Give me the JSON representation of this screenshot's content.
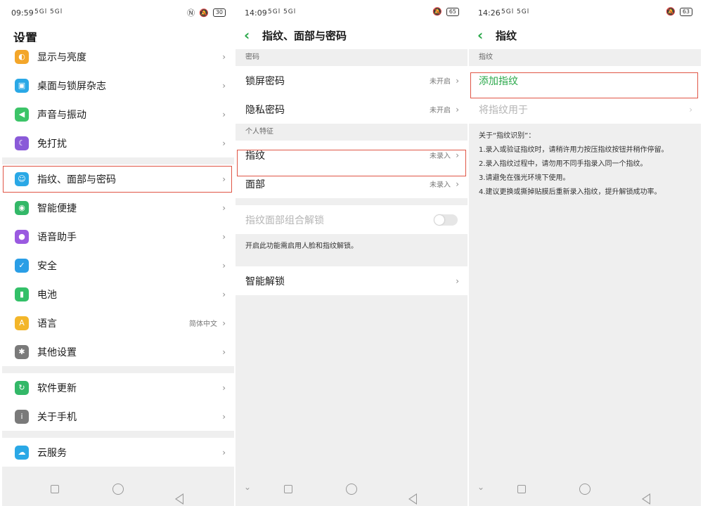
{
  "panel1": {
    "status": {
      "time": "09:59",
      "signal": "5Gl 5Gl",
      "battery": "30"
    },
    "title": "设置",
    "items": [
      {
        "label": "显示与亮度",
        "value": "",
        "icon": "brightness-icon",
        "color": "#f3a62a"
      },
      {
        "label": "桌面与锁屏杂志",
        "value": "",
        "icon": "wallpaper-icon",
        "color": "#2aa8e6"
      },
      {
        "label": "声音与振动",
        "value": "",
        "icon": "sound-icon",
        "color": "#3cc468"
      },
      {
        "label": "免打扰",
        "value": "",
        "icon": "moon-icon",
        "color": "#8a5ad8"
      },
      {
        "label": "指纹、面部与密码",
        "value": "",
        "icon": "fingerprint-face-icon",
        "color": "#2aa8e6"
      },
      {
        "label": "智能便捷",
        "value": "",
        "icon": "smart-icon",
        "color": "#33b868"
      },
      {
        "label": "语音助手",
        "value": "",
        "icon": "mic-icon",
        "color": "#9a5ae0"
      },
      {
        "label": "安全",
        "value": "",
        "icon": "shield-icon",
        "color": "#2a9ee6"
      },
      {
        "label": "电池",
        "value": "",
        "icon": "battery-icon",
        "color": "#33c068"
      },
      {
        "label": "语言",
        "value": "简体中文",
        "icon": "language-icon",
        "color": "#f3b62a"
      },
      {
        "label": "其他设置",
        "value": "",
        "icon": "gear-icon",
        "color": "#7a7a7a"
      },
      {
        "label": "软件更新",
        "value": "",
        "icon": "update-icon",
        "color": "#33b868"
      },
      {
        "label": "关于手机",
        "value": "",
        "icon": "info-icon",
        "color": "#7a7a7a"
      },
      {
        "label": "云服务",
        "value": "",
        "icon": "cloud-icon",
        "color": "#2aa8e6"
      }
    ]
  },
  "panel2": {
    "status": {
      "time": "14:09",
      "signal": "5Gl 5Gl",
      "battery": "65"
    },
    "title": "指纹、面部与密码",
    "section_password": "密码",
    "lock_password": "锁屏密码",
    "lock_password_value": "未开启",
    "privacy_password": "隐私密码",
    "privacy_password_value": "未开启",
    "section_personal": "个人特征",
    "fingerprint": "指纹",
    "fingerprint_value": "未录入",
    "face": "面部",
    "face_value": "未录入",
    "combo_unlock": "指纹面部组合解锁",
    "combo_note": "开启此功能需启用人脸和指纹解锁。",
    "smart_unlock": "智能解锁"
  },
  "panel3": {
    "status": {
      "time": "14:26",
      "signal": "5Gl 5Gl",
      "battery": "63"
    },
    "title": "指纹",
    "section": "指纹",
    "add_fingerprint": "添加指纹",
    "use_fingerprint_for": "将指纹用于",
    "about_title": "关于“指纹识别”：",
    "tips": [
      "1.录入或验证指纹时，请稍许用力按压指纹按钮并稍作停留。",
      "2.录入指纹过程中，请勿用不同手指录入同一个指纹。",
      "3.请避免在强光环境下使用。",
      "4.建议更换或撕掉贴膜后重新录入指纹，提升解锁成功率。"
    ]
  },
  "colors": {
    "accent": "#2aa84a",
    "highlight": "#e05545"
  }
}
